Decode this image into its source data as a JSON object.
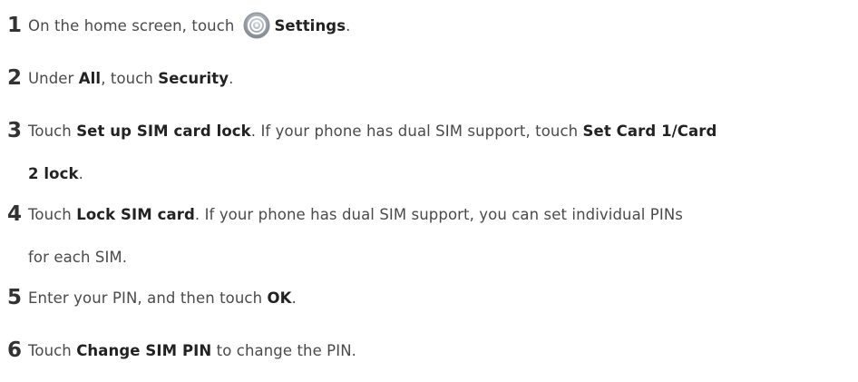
{
  "steps": [
    {
      "number": "1",
      "segments": [
        "On the home screen, touch",
        "Settings",
        "."
      ],
      "icon": "settings-gear-icon"
    },
    {
      "number": "2",
      "segments": [
        "Under ",
        "All",
        ", touch ",
        "Security",
        "."
      ]
    },
    {
      "number": "3",
      "line1": [
        "Touch ",
        "Set up SIM card lock",
        ". If your phone has dual SIM support, touch ",
        "Set Card 1/Card"
      ],
      "line2": [
        "2 lock",
        "."
      ]
    },
    {
      "number": "4",
      "line1": [
        "Touch ",
        "Lock SIM card",
        ". If your phone has dual SIM support, you can set individual PINs"
      ],
      "line2": [
        "for each SIM."
      ]
    },
    {
      "number": "5",
      "segments": [
        "Enter your PIN, and then touch ",
        "OK",
        "."
      ]
    },
    {
      "number": "6",
      "segments": [
        "Touch ",
        "Change SIM PIN",
        " to change the PIN."
      ]
    }
  ],
  "colors": {
    "text": "#4a4a4a",
    "number": "#333333",
    "bold": "#222222"
  }
}
